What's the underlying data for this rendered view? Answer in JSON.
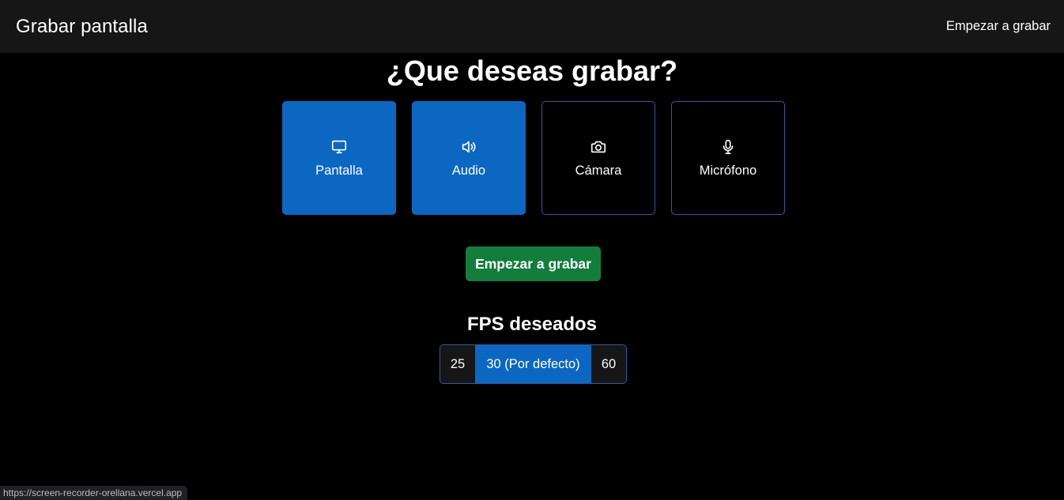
{
  "navbar": {
    "brand": "Grabar pantalla",
    "link": "Empezar a grabar"
  },
  "heading": "¿Que deseas grabar?",
  "options": [
    {
      "label": "Pantalla",
      "icon": "monitor-icon",
      "selected": true
    },
    {
      "label": "Audio",
      "icon": "speaker-icon",
      "selected": true
    },
    {
      "label": "Cámara",
      "icon": "camera-icon",
      "selected": false
    },
    {
      "label": "Micrófono",
      "icon": "microphone-icon",
      "selected": false
    }
  ],
  "start_button": "Empezar a grabar",
  "fps": {
    "title": "FPS deseados",
    "options": [
      "25",
      "30 (Por defecto)",
      "60"
    ],
    "selected": "30 (Por defecto)"
  },
  "status_bar": {
    "url": "https://screen-recorder-orellana.vercel.app"
  },
  "colors": {
    "navbar_bg": "#161616",
    "page_bg": "#000000",
    "selected_blue": "#0b67c2",
    "border_blue": "#2a5ba8",
    "start_green": "#137d3c"
  }
}
